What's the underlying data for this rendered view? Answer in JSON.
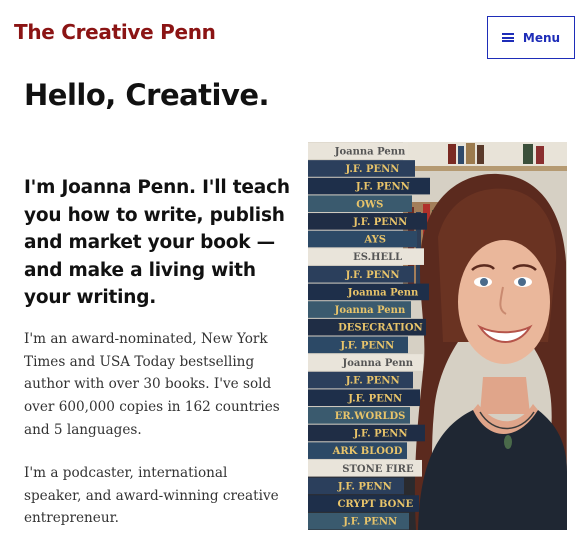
{
  "header": {
    "site_title": "The Creative Penn",
    "menu_label": "Menu"
  },
  "main": {
    "heading": "Hello, Creative.",
    "intro": "I'm Joanna Penn. I'll teach you how to write, publish and market your book — and make a living with your writing.",
    "paragraphs": [
      "I'm an award-nominated, New York Times and USA Today bestselling author with over 30 books. I've sold over 600,000 copies in 162 countries and 5 languages.",
      "I'm a podcaster, international speaker, and award-winning creative entrepreneur."
    ]
  },
  "photo": {
    "book_spines": [
      "Joanna Penn",
      "J.F. PENN",
      "J.F. PENN",
      "OWS",
      "J.F. PENN",
      "AYS",
      "ES.HELL",
      "J.F. PENN",
      "Joanna Penn",
      "Joanna Penn",
      "DESECRATION",
      "J.F. PENN",
      "Joanna Penn",
      "J.F. PENN",
      "J.F. PENN",
      "ER.WORLDS",
      "J.F. PENN",
      "ARK BLOOD",
      "STONE FIRE",
      "J.F. PENN",
      "CRYPT BONE",
      "J.F. PENN"
    ]
  },
  "colors": {
    "brand": "#8b1414",
    "accent": "#1e2db8"
  }
}
